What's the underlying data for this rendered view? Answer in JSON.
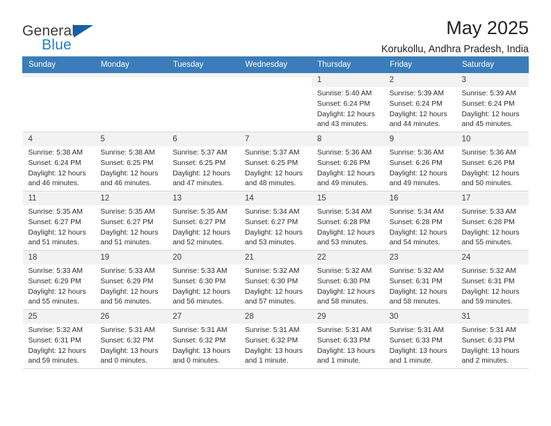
{
  "brand": {
    "line1": "General",
    "line2": "Blue",
    "mark": "triangle-logo"
  },
  "header": {
    "title": "May 2025",
    "subtitle": "Korukollu, Andhra Pradesh, India"
  },
  "calendar": {
    "weekday_headers": [
      "Sunday",
      "Monday",
      "Tuesday",
      "Wednesday",
      "Thursday",
      "Friday",
      "Saturday"
    ],
    "accent_color": "#3a7dba",
    "daynum_bg": "#f2f2f2",
    "weeks": [
      [
        {
          "day": "",
          "empty": true
        },
        {
          "day": "",
          "empty": true
        },
        {
          "day": "",
          "empty": true
        },
        {
          "day": "",
          "empty": true
        },
        {
          "day": "1",
          "sunrise": "Sunrise: 5:40 AM",
          "sunset": "Sunset: 6:24 PM",
          "daylight": "Daylight: 12 hours and 43 minutes."
        },
        {
          "day": "2",
          "sunrise": "Sunrise: 5:39 AM",
          "sunset": "Sunset: 6:24 PM",
          "daylight": "Daylight: 12 hours and 44 minutes."
        },
        {
          "day": "3",
          "sunrise": "Sunrise: 5:39 AM",
          "sunset": "Sunset: 6:24 PM",
          "daylight": "Daylight: 12 hours and 45 minutes."
        }
      ],
      [
        {
          "day": "4",
          "sunrise": "Sunrise: 5:38 AM",
          "sunset": "Sunset: 6:24 PM",
          "daylight": "Daylight: 12 hours and 46 minutes."
        },
        {
          "day": "5",
          "sunrise": "Sunrise: 5:38 AM",
          "sunset": "Sunset: 6:25 PM",
          "daylight": "Daylight: 12 hours and 46 minutes."
        },
        {
          "day": "6",
          "sunrise": "Sunrise: 5:37 AM",
          "sunset": "Sunset: 6:25 PM",
          "daylight": "Daylight: 12 hours and 47 minutes."
        },
        {
          "day": "7",
          "sunrise": "Sunrise: 5:37 AM",
          "sunset": "Sunset: 6:25 PM",
          "daylight": "Daylight: 12 hours and 48 minutes."
        },
        {
          "day": "8",
          "sunrise": "Sunrise: 5:36 AM",
          "sunset": "Sunset: 6:26 PM",
          "daylight": "Daylight: 12 hours and 49 minutes."
        },
        {
          "day": "9",
          "sunrise": "Sunrise: 5:36 AM",
          "sunset": "Sunset: 6:26 PM",
          "daylight": "Daylight: 12 hours and 49 minutes."
        },
        {
          "day": "10",
          "sunrise": "Sunrise: 5:36 AM",
          "sunset": "Sunset: 6:26 PM",
          "daylight": "Daylight: 12 hours and 50 minutes."
        }
      ],
      [
        {
          "day": "11",
          "sunrise": "Sunrise: 5:35 AM",
          "sunset": "Sunset: 6:27 PM",
          "daylight": "Daylight: 12 hours and 51 minutes."
        },
        {
          "day": "12",
          "sunrise": "Sunrise: 5:35 AM",
          "sunset": "Sunset: 6:27 PM",
          "daylight": "Daylight: 12 hours and 51 minutes."
        },
        {
          "day": "13",
          "sunrise": "Sunrise: 5:35 AM",
          "sunset": "Sunset: 6:27 PM",
          "daylight": "Daylight: 12 hours and 52 minutes."
        },
        {
          "day": "14",
          "sunrise": "Sunrise: 5:34 AM",
          "sunset": "Sunset: 6:27 PM",
          "daylight": "Daylight: 12 hours and 53 minutes."
        },
        {
          "day": "15",
          "sunrise": "Sunrise: 5:34 AM",
          "sunset": "Sunset: 6:28 PM",
          "daylight": "Daylight: 12 hours and 53 minutes."
        },
        {
          "day": "16",
          "sunrise": "Sunrise: 5:34 AM",
          "sunset": "Sunset: 6:28 PM",
          "daylight": "Daylight: 12 hours and 54 minutes."
        },
        {
          "day": "17",
          "sunrise": "Sunrise: 5:33 AM",
          "sunset": "Sunset: 6:28 PM",
          "daylight": "Daylight: 12 hours and 55 minutes."
        }
      ],
      [
        {
          "day": "18",
          "sunrise": "Sunrise: 5:33 AM",
          "sunset": "Sunset: 6:29 PM",
          "daylight": "Daylight: 12 hours and 55 minutes."
        },
        {
          "day": "19",
          "sunrise": "Sunrise: 5:33 AM",
          "sunset": "Sunset: 6:29 PM",
          "daylight": "Daylight: 12 hours and 56 minutes."
        },
        {
          "day": "20",
          "sunrise": "Sunrise: 5:33 AM",
          "sunset": "Sunset: 6:30 PM",
          "daylight": "Daylight: 12 hours and 56 minutes."
        },
        {
          "day": "21",
          "sunrise": "Sunrise: 5:32 AM",
          "sunset": "Sunset: 6:30 PM",
          "daylight": "Daylight: 12 hours and 57 minutes."
        },
        {
          "day": "22",
          "sunrise": "Sunrise: 5:32 AM",
          "sunset": "Sunset: 6:30 PM",
          "daylight": "Daylight: 12 hours and 58 minutes."
        },
        {
          "day": "23",
          "sunrise": "Sunrise: 5:32 AM",
          "sunset": "Sunset: 6:31 PM",
          "daylight": "Daylight: 12 hours and 58 minutes."
        },
        {
          "day": "24",
          "sunrise": "Sunrise: 5:32 AM",
          "sunset": "Sunset: 6:31 PM",
          "daylight": "Daylight: 12 hours and 59 minutes."
        }
      ],
      [
        {
          "day": "25",
          "sunrise": "Sunrise: 5:32 AM",
          "sunset": "Sunset: 6:31 PM",
          "daylight": "Daylight: 12 hours and 59 minutes."
        },
        {
          "day": "26",
          "sunrise": "Sunrise: 5:31 AM",
          "sunset": "Sunset: 6:32 PM",
          "daylight": "Daylight: 13 hours and 0 minutes."
        },
        {
          "day": "27",
          "sunrise": "Sunrise: 5:31 AM",
          "sunset": "Sunset: 6:32 PM",
          "daylight": "Daylight: 13 hours and 0 minutes."
        },
        {
          "day": "28",
          "sunrise": "Sunrise: 5:31 AM",
          "sunset": "Sunset: 6:32 PM",
          "daylight": "Daylight: 13 hours and 1 minute."
        },
        {
          "day": "29",
          "sunrise": "Sunrise: 5:31 AM",
          "sunset": "Sunset: 6:33 PM",
          "daylight": "Daylight: 13 hours and 1 minute."
        },
        {
          "day": "30",
          "sunrise": "Sunrise: 5:31 AM",
          "sunset": "Sunset: 6:33 PM",
          "daylight": "Daylight: 13 hours and 1 minute."
        },
        {
          "day": "31",
          "sunrise": "Sunrise: 5:31 AM",
          "sunset": "Sunset: 6:33 PM",
          "daylight": "Daylight: 13 hours and 2 minutes."
        }
      ]
    ]
  }
}
